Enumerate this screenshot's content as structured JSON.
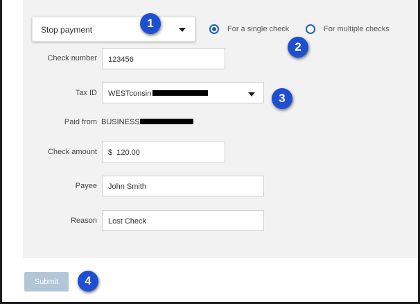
{
  "action_select": {
    "value": "Stop payment",
    "arrow_icon": "caret-down"
  },
  "check_mode": {
    "options": [
      {
        "label": "For a single check",
        "selected": true
      },
      {
        "label": "For multiple checks",
        "selected": false
      }
    ]
  },
  "form": {
    "check_number": {
      "label": "Check number",
      "value": "123456"
    },
    "tax_id": {
      "label": "Tax ID",
      "value": "WESTconsin",
      "redacted": true,
      "arrow_icon": "caret-down"
    },
    "paid_from": {
      "label": "Paid from",
      "value": "BUSINESS",
      "redacted": true
    },
    "check_amount": {
      "label": "Check amount",
      "currency": "$",
      "value": "120.00"
    },
    "payee": {
      "label": "Payee",
      "value": "John Smith"
    },
    "reason": {
      "label": "Reason",
      "value": "Lost Check"
    }
  },
  "submit": {
    "label": "Submit"
  },
  "callouts": [
    "1",
    "2",
    "3",
    "4"
  ],
  "colors": {
    "panel_bg": "#f2f2f2",
    "radio_accent": "#1a5fb4",
    "submit_bg": "#b3c6d8",
    "callout_bg": "#1f4fd1",
    "frame": "#1b1b1b"
  }
}
